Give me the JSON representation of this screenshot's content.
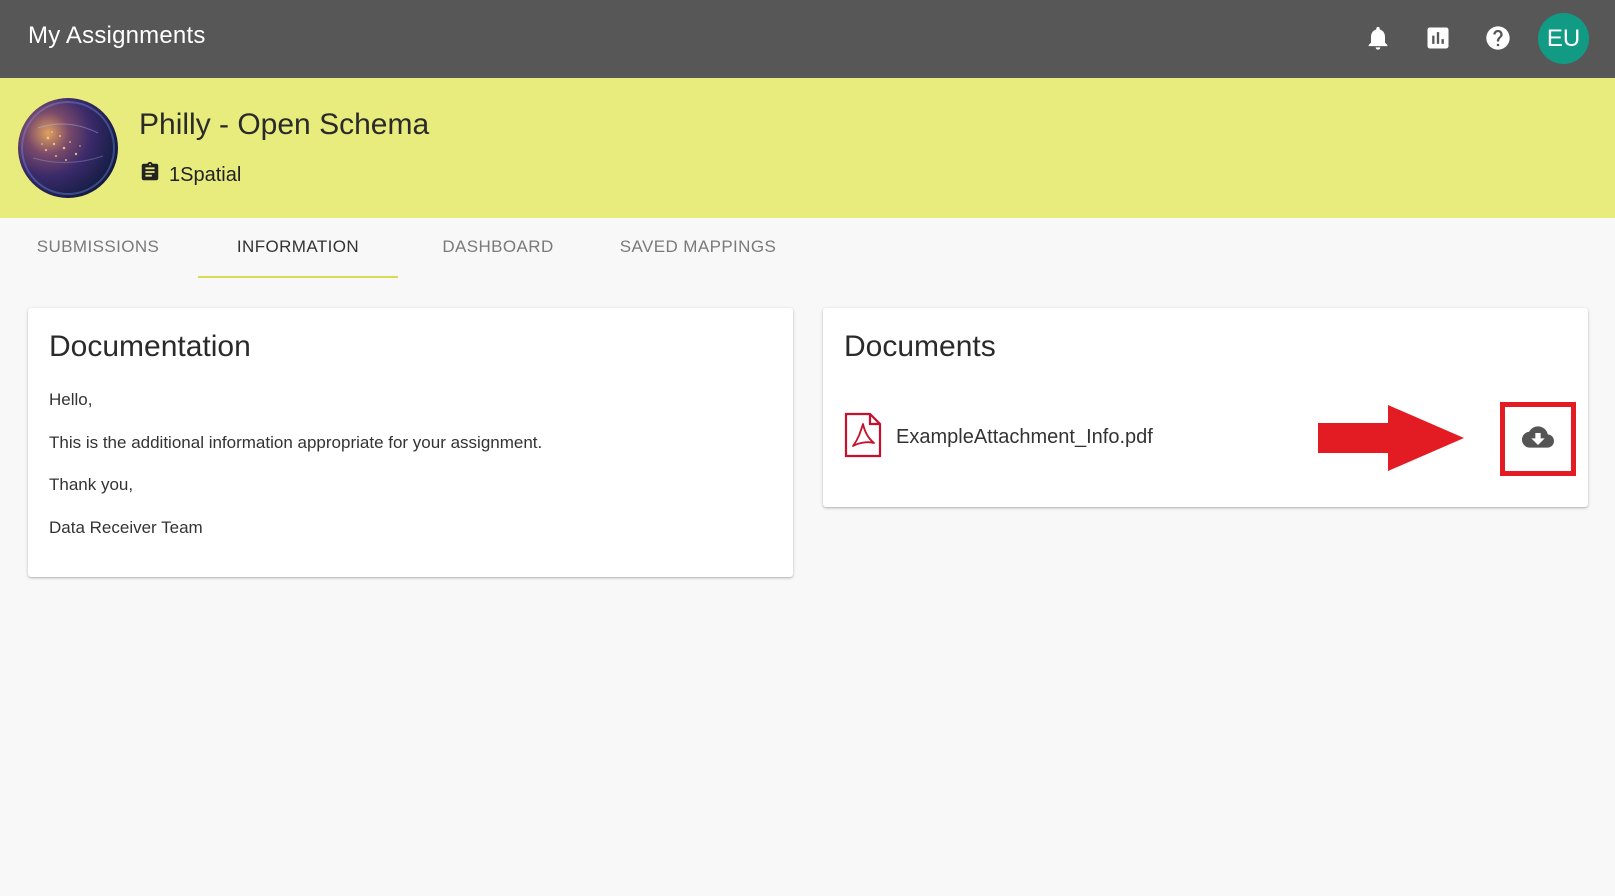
{
  "app": {
    "title": "My Assignments"
  },
  "topbar": {
    "icons": [
      "bell-icon",
      "chart-icon",
      "help-icon"
    ],
    "avatar_initials": "EU",
    "avatar_color": "#119b85"
  },
  "project": {
    "title": "Philly - Open Schema",
    "organization": "1Spatial",
    "band_color": "#e8ec7d"
  },
  "tabs": [
    {
      "label": "SUBMISSIONS",
      "active": false
    },
    {
      "label": "INFORMATION",
      "active": true
    },
    {
      "label": "DASHBOARD",
      "active": false
    },
    {
      "label": "SAVED MAPPINGS",
      "active": false
    }
  ],
  "documentation": {
    "title": "Documentation",
    "paragraphs": [
      "Hello,",
      "This is the additional information appropriate for your assignment.",
      "Thank you,",
      "Data Receiver Team"
    ]
  },
  "documents": {
    "title": "Documents",
    "files": [
      {
        "name": "ExampleAttachment_Info.pdf",
        "icon": "pdf-icon"
      }
    ],
    "download_icon": "cloud-download-icon",
    "highlight_color": "#e31b23"
  }
}
